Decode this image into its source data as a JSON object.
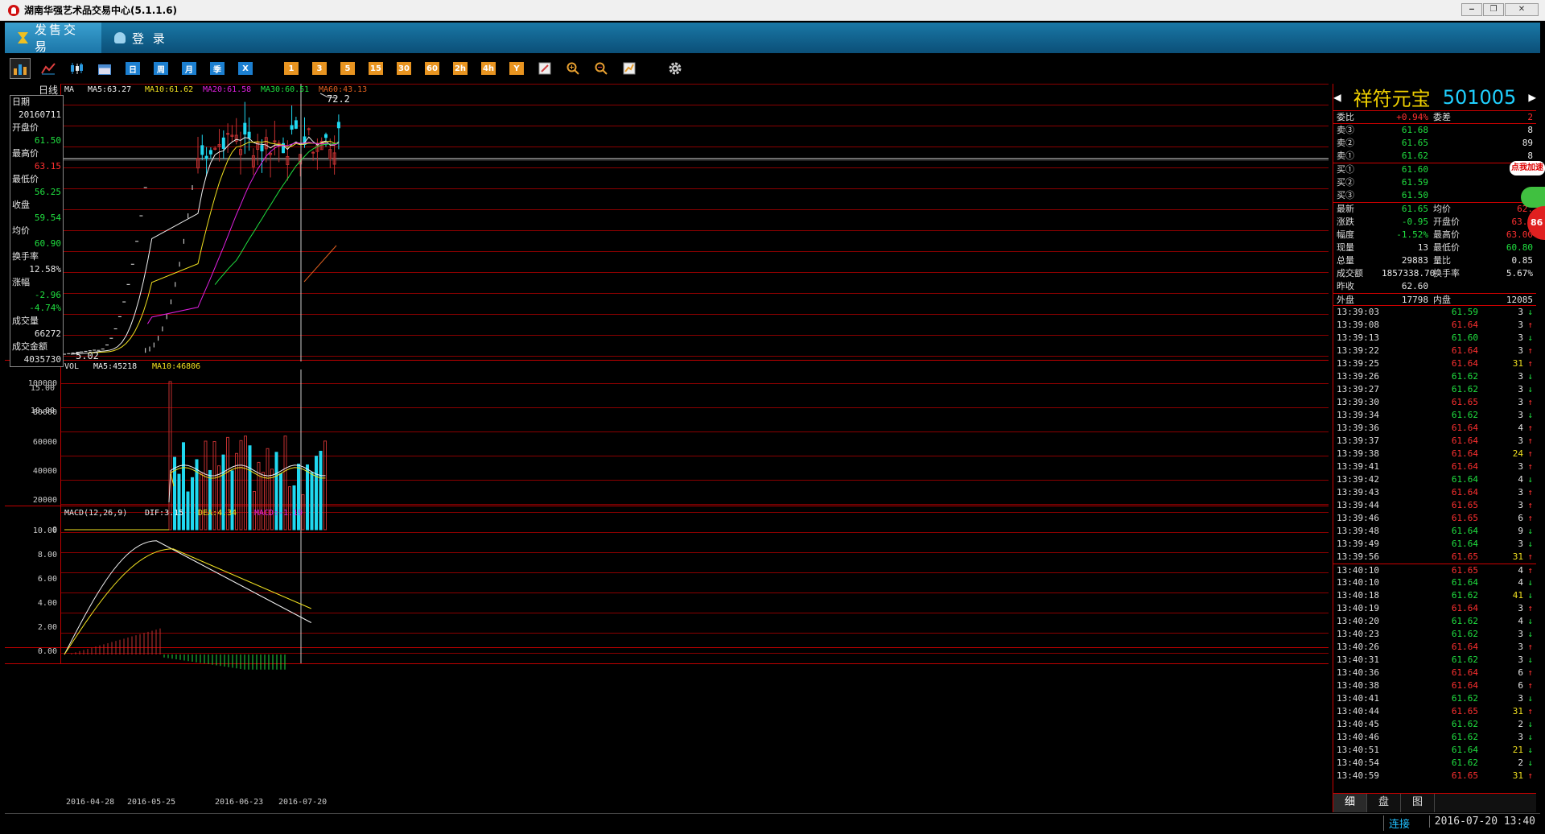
{
  "window": {
    "title": "湖南华强艺术品交易中心(5.1.1.6)",
    "buttons": [
      "‒",
      "❐",
      "✕"
    ]
  },
  "app_tabs": [
    {
      "label": "发售交易",
      "icon": "sell-icon",
      "active": true
    },
    {
      "label": "登 录",
      "icon": "user-icon",
      "active": false
    }
  ],
  "toolbar": {
    "view_icons": [
      "bar-chart-icon",
      "line-chart-icon",
      "candlestick-icon",
      "calendar-icon"
    ],
    "periods": [
      "日",
      "周",
      "月",
      "季",
      "X"
    ],
    "minutes": [
      "1",
      "3",
      "5",
      "15",
      "30",
      "60",
      "2h",
      "4h",
      "Y"
    ],
    "tools": [
      "pen-icon",
      "zoom-in-icon",
      "zoom-out-icon",
      "draw-icon",
      "settings-icon"
    ]
  },
  "chart": {
    "period_label": "日线",
    "ma_prefix": "MA",
    "ma_values": [
      {
        "label": "MA5:63.27",
        "color": "#f0f0f0"
      },
      {
        "label": "MA10:61.62",
        "color": "#f0e020"
      },
      {
        "label": "MA20:61.58",
        "color": "#e020e0"
      },
      {
        "label": "MA30:60.51",
        "color": "#20e040"
      },
      {
        "label": "MA60:43.13",
        "color": "#e06020"
      }
    ],
    "price_axis": [
      "15.00",
      "10.00"
    ],
    "high_mark": "72.2",
    "low_mark": "5.02",
    "vol_prefix": "VOL",
    "vol_ma": [
      {
        "label": "MA5:45218",
        "color": "#f0f0f0"
      },
      {
        "label": "MA10:46806",
        "color": "#f0e020"
      }
    ],
    "vol_axis": [
      "100000",
      "80000",
      "60000",
      "40000",
      "20000",
      "0"
    ],
    "macd_prefix": "MACD(12,26,9)",
    "macd_values": [
      {
        "label": "DIF:3.15",
        "color": "#f0f0f0"
      },
      {
        "label": "DEA:4.34",
        "color": "#f0e020"
      },
      {
        "label": "MACD:-1.19",
        "color": "#e020e0"
      }
    ],
    "macd_axis": [
      "10.00",
      "8.00",
      "6.00",
      "4.00",
      "2.00",
      "0.00"
    ],
    "date_labels": [
      "2016-04-28",
      "2016-05-25",
      "2016-06-23",
      "2016-07-20"
    ]
  },
  "info": [
    {
      "label": "日期",
      "value": "20160711",
      "color": "#e8e8e8"
    },
    {
      "label": "开盘价",
      "value": "61.50",
      "color": "#20e040"
    },
    {
      "label": "最高价",
      "value": "63.15",
      "color": "#ff3030"
    },
    {
      "label": "最低价",
      "value": "56.25",
      "color": "#20e040"
    },
    {
      "label": "收盘",
      "value": "59.54",
      "color": "#20e040"
    },
    {
      "label": "均价",
      "value": "60.90",
      "color": "#20e040"
    },
    {
      "label": "换手率",
      "value": "12.58%",
      "color": "#e8e8e8"
    },
    {
      "label": "涨幅",
      "value": "-2.96",
      "color": "#20e040",
      "value2": "-4.74%"
    },
    {
      "label": "成交量",
      "value": "66272",
      "color": "#e8e8e8"
    },
    {
      "label": "成交金额",
      "value": "4035730",
      "color": "#e8e8e8"
    }
  ],
  "quote": {
    "name": "祥符元宝",
    "code": "501005",
    "weibi_label": "委比",
    "weibi": "+0.94%",
    "weicha_label": "委差",
    "weicha": "2",
    "asks": [
      {
        "label": "卖③",
        "price": "61.68",
        "vol": "8"
      },
      {
        "label": "卖②",
        "price": "61.65",
        "vol": "89"
      },
      {
        "label": "卖①",
        "price": "61.62",
        "vol": "8"
      }
    ],
    "bids": [
      {
        "label": "买①",
        "price": "61.60",
        "vol": ""
      },
      {
        "label": "买②",
        "price": "61.59",
        "vol": ""
      },
      {
        "label": "买③",
        "price": "61.50",
        "vol": ""
      }
    ],
    "stats": [
      {
        "l1": "最新",
        "v1": "61.65",
        "c1": "green",
        "l2": "均价",
        "v2": "62.",
        "c2": "red"
      },
      {
        "l1": "涨跌",
        "v1": "-0.95",
        "c1": "green",
        "l2": "开盘价",
        "v2": "63.0",
        "c2": "red"
      },
      {
        "l1": "幅度",
        "v1": "-1.52%",
        "c1": "green",
        "l2": "最高价",
        "v2": "63.00",
        "c2": "red"
      },
      {
        "l1": "现量",
        "v1": "13",
        "c1": "white",
        "l2": "最低价",
        "v2": "60.80",
        "c2": "green"
      },
      {
        "l1": "总量",
        "v1": "29883",
        "c1": "white",
        "l2": "量比",
        "v2": "0.85",
        "c2": "white"
      },
      {
        "l1": "成交额",
        "v1": "1857338.70",
        "c1": "white",
        "l2": "换手率",
        "v2": "5.67%",
        "c2": "white"
      },
      {
        "l1": "昨收",
        "v1": "62.60",
        "c1": "white",
        "l2": "",
        "v2": "",
        "c2": "white"
      }
    ],
    "outer_label": "外盘",
    "outer": "17798",
    "inner_label": "内盘",
    "inner": "12085"
  },
  "ticks": [
    {
      "t": "13:39:03",
      "p": "61.59",
      "v": "3",
      "d": "down"
    },
    {
      "t": "13:39:08",
      "p": "61.64",
      "v": "3",
      "d": "up"
    },
    {
      "t": "13:39:13",
      "p": "61.60",
      "v": "3",
      "d": "down"
    },
    {
      "t": "13:39:22",
      "p": "61.64",
      "v": "3",
      "d": "up"
    },
    {
      "t": "13:39:25",
      "p": "61.64",
      "v": "31",
      "d": "up"
    },
    {
      "t": "13:39:26",
      "p": "61.62",
      "v": "3",
      "d": "down"
    },
    {
      "t": "13:39:27",
      "p": "61.62",
      "v": "3",
      "d": "down"
    },
    {
      "t": "13:39:30",
      "p": "61.65",
      "v": "3",
      "d": "up"
    },
    {
      "t": "13:39:34",
      "p": "61.62",
      "v": "3",
      "d": "down"
    },
    {
      "t": "13:39:36",
      "p": "61.64",
      "v": "4",
      "d": "up"
    },
    {
      "t": "13:39:37",
      "p": "61.64",
      "v": "3",
      "d": "up"
    },
    {
      "t": "13:39:38",
      "p": "61.64",
      "v": "24",
      "d": "up"
    },
    {
      "t": "13:39:41",
      "p": "61.64",
      "v": "3",
      "d": "up"
    },
    {
      "t": "13:39:42",
      "p": "61.64",
      "v": "4",
      "d": "down"
    },
    {
      "t": "13:39:43",
      "p": "61.64",
      "v": "3",
      "d": "up"
    },
    {
      "t": "13:39:44",
      "p": "61.65",
      "v": "3",
      "d": "up"
    },
    {
      "t": "13:39:46",
      "p": "61.65",
      "v": "6",
      "d": "up"
    },
    {
      "t": "13:39:48",
      "p": "61.64",
      "v": "9",
      "d": "down"
    },
    {
      "t": "13:39:49",
      "p": "61.64",
      "v": "3",
      "d": "down"
    },
    {
      "t": "13:39:56",
      "p": "61.65",
      "v": "31",
      "d": "up"
    },
    {
      "t": "13:40:10",
      "p": "61.65",
      "v": "4",
      "d": "up"
    },
    {
      "t": "13:40:10",
      "p": "61.64",
      "v": "4",
      "d": "down"
    },
    {
      "t": "13:40:18",
      "p": "61.62",
      "v": "41",
      "d": "down"
    },
    {
      "t": "13:40:19",
      "p": "61.64",
      "v": "3",
      "d": "up"
    },
    {
      "t": "13:40:20",
      "p": "61.62",
      "v": "4",
      "d": "down"
    },
    {
      "t": "13:40:23",
      "p": "61.62",
      "v": "3",
      "d": "down"
    },
    {
      "t": "13:40:26",
      "p": "61.64",
      "v": "3",
      "d": "up"
    },
    {
      "t": "13:40:31",
      "p": "61.62",
      "v": "3",
      "d": "down"
    },
    {
      "t": "13:40:36",
      "p": "61.64",
      "v": "6",
      "d": "up"
    },
    {
      "t": "13:40:38",
      "p": "61.64",
      "v": "6",
      "d": "up"
    },
    {
      "t": "13:40:41",
      "p": "61.62",
      "v": "3",
      "d": "down"
    },
    {
      "t": "13:40:44",
      "p": "61.65",
      "v": "31",
      "d": "up"
    },
    {
      "t": "13:40:45",
      "p": "61.62",
      "v": "2",
      "d": "down"
    },
    {
      "t": "13:40:46",
      "p": "61.62",
      "v": "3",
      "d": "down"
    },
    {
      "t": "13:40:51",
      "p": "61.64",
      "v": "21",
      "d": "down"
    },
    {
      "t": "13:40:54",
      "p": "61.62",
      "v": "2",
      "d": "down"
    },
    {
      "t": "13:40:59",
      "p": "61.65",
      "v": "31",
      "d": "up"
    }
  ],
  "panel_tabs": [
    "细",
    "盘",
    "图"
  ],
  "ad": {
    "bubble": "点我加速",
    "badge": "86"
  },
  "status": {
    "connection": "连接",
    "datetime": "2016-07-20 13:40"
  }
}
